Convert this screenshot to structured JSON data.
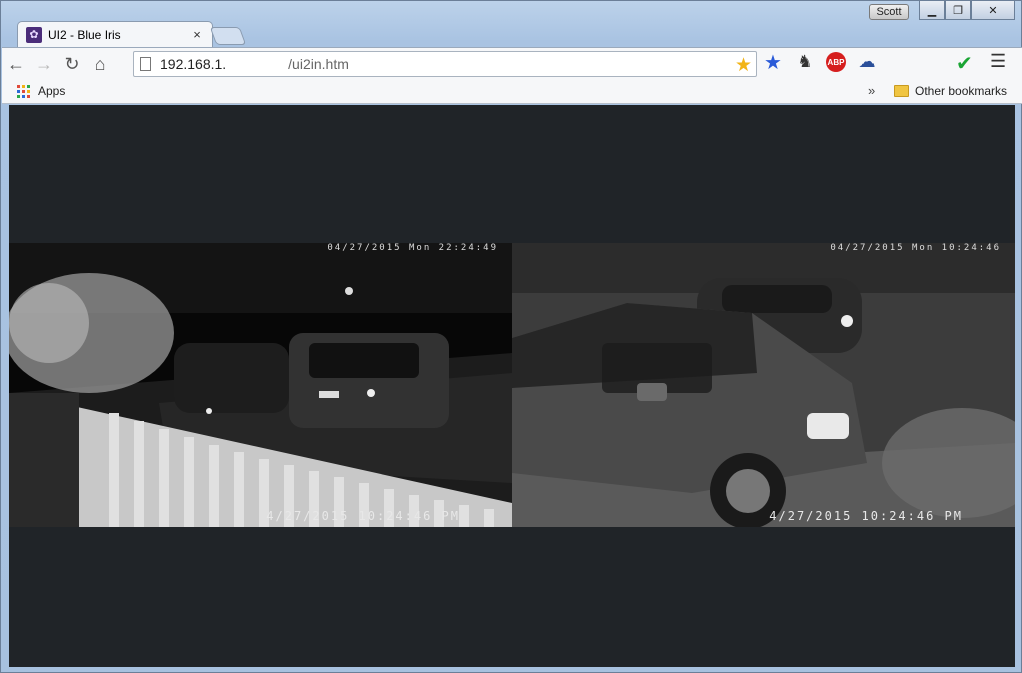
{
  "browser": {
    "tab_title": "UI2 - Blue Iris",
    "tab_close": "×",
    "user_name": "Scott",
    "url_host": "192.168.1.",
    "url_path": "/ui2in.htm",
    "bookmarks": {
      "apps_label": "Apps",
      "overflow": "»",
      "other_label": "Other bookmarks"
    }
  },
  "icons": {
    "back": "arrow-left-icon",
    "forward": "arrow-right-icon",
    "reload": "reload-icon",
    "home": "home-icon",
    "bookmark_star": "star-icon",
    "menu": "hamburger-menu-icon"
  },
  "cameras": [
    {
      "name": "left-camera",
      "overlay_top": "04/27/2015 Mon 22:24:49",
      "timestamp": "4/27/2015 10:24:46 PM"
    },
    {
      "name": "right-camera",
      "overlay_top": "04/27/2015 Mon 10:24:46",
      "timestamp": "4/27/2015 10:24:46 PM"
    }
  ],
  "colors": {
    "content_bg": "#202428",
    "star": "#f2b417",
    "abp": "#d61f1f",
    "check": "#1aa534"
  }
}
